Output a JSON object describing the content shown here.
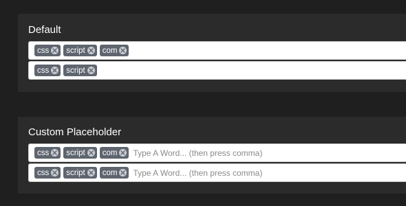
{
  "panels": [
    {
      "title": "Default",
      "inputs": [
        {
          "tags": [
            "css",
            "script",
            "com"
          ],
          "placeholder": ""
        },
        {
          "tags": [
            "css",
            "script"
          ],
          "placeholder": ""
        }
      ]
    },
    {
      "title": "Custom Placeholder",
      "inputs": [
        {
          "tags": [
            "css",
            "script",
            "com"
          ],
          "placeholder": "Type A Word... (then press comma)"
        },
        {
          "tags": [
            "css",
            "script",
            "com"
          ],
          "placeholder": "Type A Word... (then press comma)"
        }
      ]
    }
  ],
  "icons": {
    "tag_remove": "close-circle-icon"
  },
  "colors": {
    "page_background": "#1f1f1f",
    "panel_background": "#2b2b2b",
    "tag_background": "#5f656e",
    "tag_text": "#ffffff",
    "remove_icon_background": "#c9ccd1",
    "input_background": "#ffffff"
  }
}
